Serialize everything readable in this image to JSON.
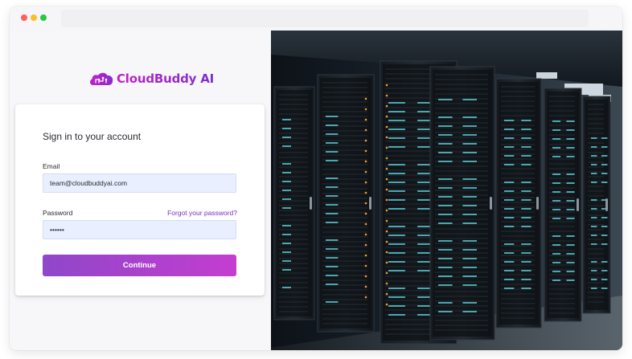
{
  "window": {
    "controls": [
      "close",
      "minimize",
      "maximize"
    ]
  },
  "brand": {
    "name": "CloudBuddy AI",
    "logo_icon": "cloud-circuit-icon",
    "colors": {
      "gradient_start": "#c020c8",
      "gradient_end": "#7d2fcf"
    }
  },
  "login": {
    "title": "Sign in to your account",
    "email_label": "Email",
    "email_value": "team@cloudbuddyai.com",
    "password_label": "Password",
    "forgot_link": "Forgot your password?",
    "password_value": "••••••",
    "continue_label": "Continue",
    "colors": {
      "accent": "#7a2dbf",
      "input_bg": "#e9efff",
      "button_start": "#8f47c9",
      "button_end": "#c43dd0"
    }
  },
  "hero": {
    "image": "server-room-photo"
  }
}
